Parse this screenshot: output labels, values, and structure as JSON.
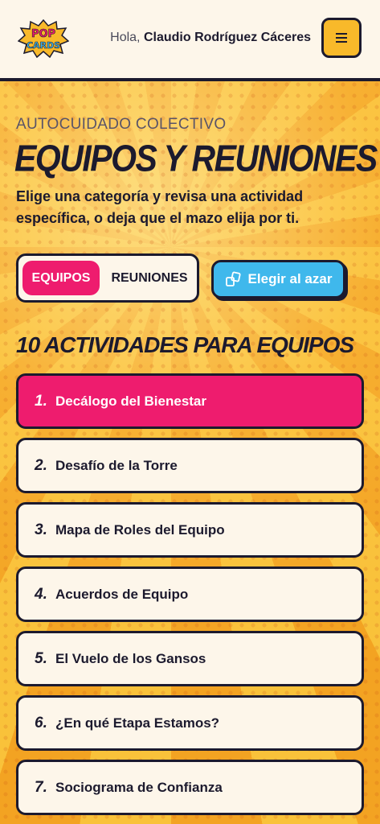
{
  "header": {
    "logo_text": "POP CARDS",
    "greeting_prefix": "Hola,",
    "user_name": "Claudio Rodríguez Cáceres",
    "menu_icon": "hamburger-icon"
  },
  "intro": {
    "eyebrow": "AUTOCUIDADO COLECTIVO",
    "title": "EQUIPOS Y REUNIONES",
    "subtitle": "Elige una categoría y revisa una actividad específica, o deja que el mazo elija por ti."
  },
  "categories": {
    "options": [
      "EQUIPOS",
      "REUNIONES"
    ],
    "selected": "EQUIPOS"
  },
  "random_button": {
    "label": "Elegir al azar",
    "icon": "shuffle-icon"
  },
  "section_title": "10 ACTIVIDADES PARA EQUIPOS",
  "activities": [
    {
      "number": "1.",
      "label": "Decálogo del Bienestar",
      "active": true
    },
    {
      "number": "2.",
      "label": "Desafío de la Torre"
    },
    {
      "number": "3.",
      "label": "Mapa de Roles del Equipo"
    },
    {
      "number": "4.",
      "label": "Acuerdos de Equipo"
    },
    {
      "number": "5.",
      "label": "El Vuelo de los Gansos"
    },
    {
      "number": "6.",
      "label": "¿En qué Etapa Estamos?"
    },
    {
      "number": "7.",
      "label": "Sociograma de Confianza"
    }
  ],
  "colors": {
    "accent_pink": "#ee1c6e",
    "accent_blue": "#3fb8ec",
    "accent_yellow": "#f8b92a",
    "ink": "#1c1a2e",
    "card_bg": "#fdf6ea"
  }
}
